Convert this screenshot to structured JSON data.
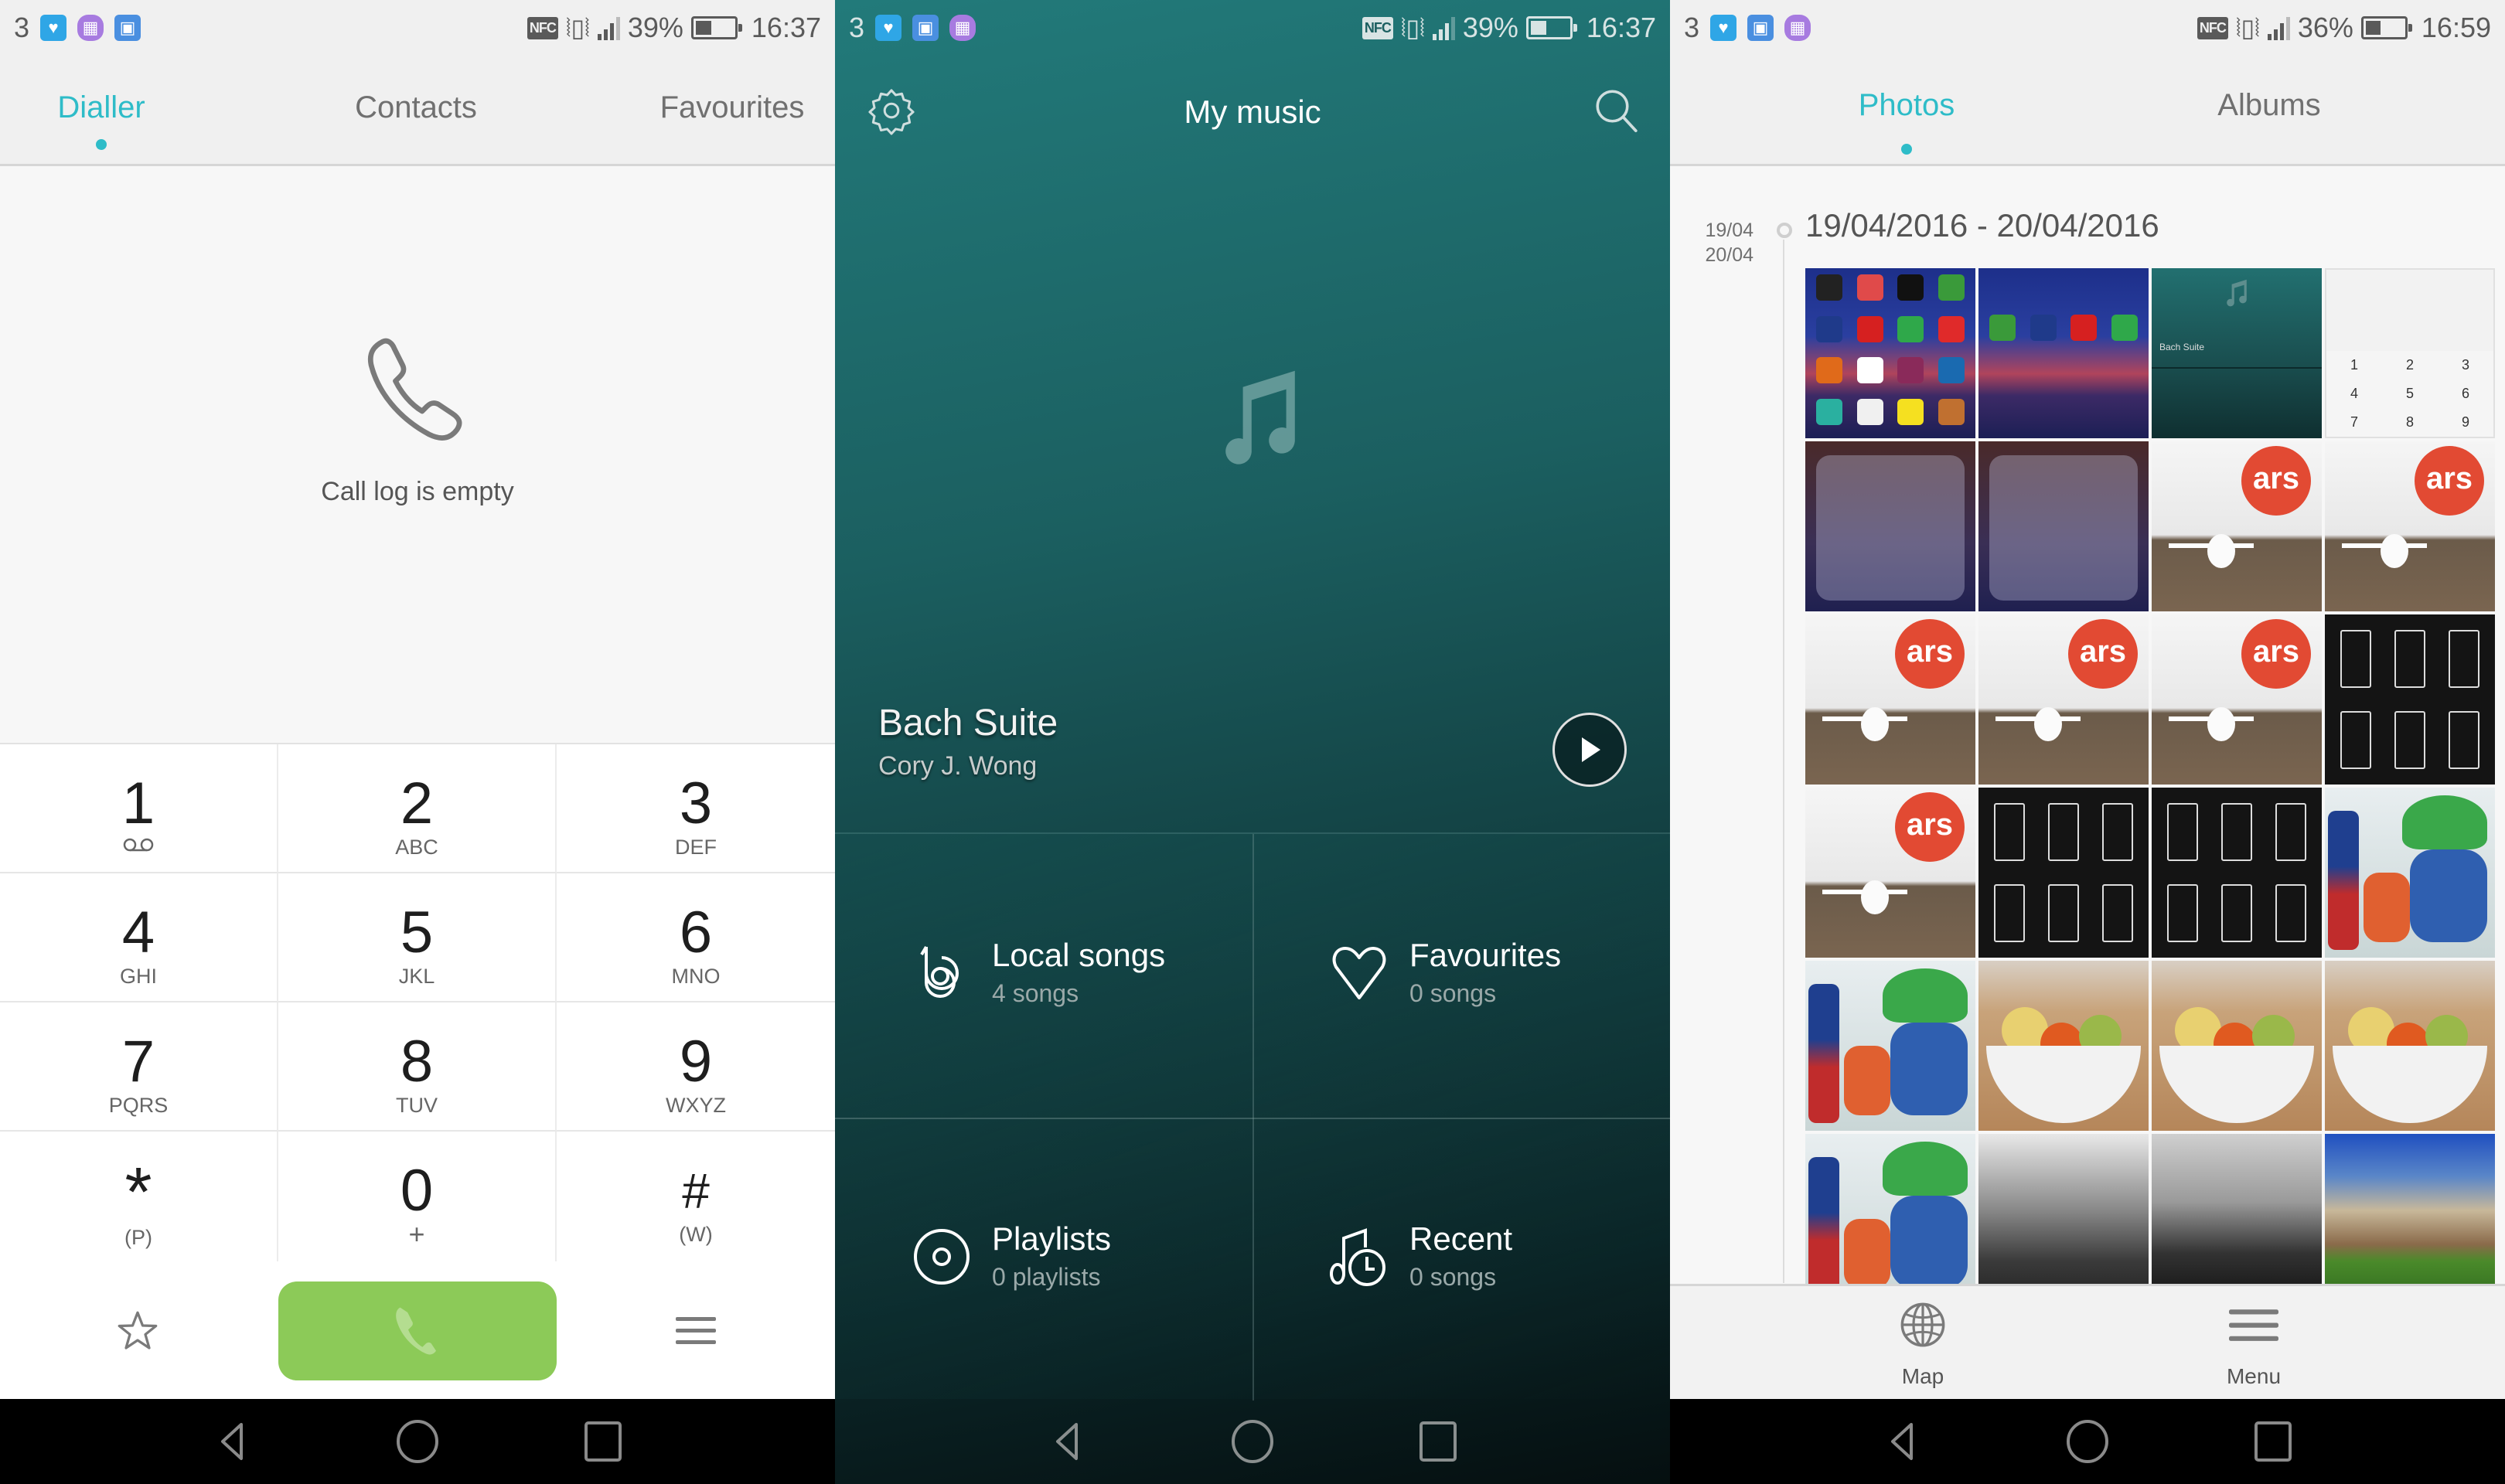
{
  "dialer": {
    "status": {
      "carrier": "3",
      "notification_icons": [
        "health-icon",
        "keyboard-icon",
        "gallery-icon"
      ],
      "nfc": "NFC",
      "battery": "39%",
      "battery_level": 0.39,
      "time": "16:37"
    },
    "tabs": [
      {
        "label": "Dialler",
        "active": true
      },
      {
        "label": "Contacts",
        "active": false
      },
      {
        "label": "Favourites",
        "active": false
      }
    ],
    "empty_state": {
      "icon": "phone-icon",
      "text": "Call log is empty"
    },
    "keys": [
      {
        "digit": "1",
        "letters": "voicemail"
      },
      {
        "digit": "2",
        "letters": "ABC"
      },
      {
        "digit": "3",
        "letters": "DEF"
      },
      {
        "digit": "4",
        "letters": "GHI"
      },
      {
        "digit": "5",
        "letters": "JKL"
      },
      {
        "digit": "6",
        "letters": "MNO"
      },
      {
        "digit": "7",
        "letters": "PQRS"
      },
      {
        "digit": "8",
        "letters": "TUV"
      },
      {
        "digit": "9",
        "letters": "WXYZ"
      },
      {
        "digit": "*",
        "letters": "(P)"
      },
      {
        "digit": "0",
        "letters": "+"
      },
      {
        "digit": "#",
        "letters": "(W)"
      }
    ],
    "bottom": {
      "left_icon": "star-icon",
      "call_icon": "phone-icon",
      "right_icon": "menu-icon"
    },
    "colors": {
      "accent": "#2ebcc8",
      "call_button": "#8cca58"
    }
  },
  "music": {
    "status": {
      "carrier": "3",
      "notification_icons": [
        "health-icon",
        "gallery-icon",
        "keyboard-icon"
      ],
      "nfc": "NFC",
      "battery": "39%",
      "battery_level": 0.39,
      "time": "16:37"
    },
    "title": "My music",
    "now_playing": {
      "title": "Bach Suite",
      "artist": "Cory J. Wong"
    },
    "categories": [
      {
        "label": "Local songs",
        "count": "4 songs",
        "icon": "local-songs-icon"
      },
      {
        "label": "Favourites",
        "count": "0 songs",
        "icon": "heart-icon"
      },
      {
        "label": "Playlists",
        "count": "0 playlists",
        "icon": "disc-icon"
      },
      {
        "label": "Recent",
        "count": "0 songs",
        "icon": "recent-clock-icon"
      }
    ]
  },
  "gallery": {
    "status": {
      "carrier": "3",
      "notification_icons": [
        "health-icon",
        "gallery-icon",
        "keyboard-icon"
      ],
      "nfc": "NFC",
      "battery": "36%",
      "battery_level": 0.36,
      "time": "16:59"
    },
    "tabs": [
      {
        "label": "Photos",
        "active": true
      },
      {
        "label": "Albums",
        "active": false
      }
    ],
    "timeline": {
      "start_short": "19/04",
      "end_short": "20/04",
      "heading": "19/04/2016 - 20/04/2016"
    },
    "photos": [
      {
        "kind": "home",
        "desc": "Home screen screenshot"
      },
      {
        "kind": "home",
        "desc": "Home screen screenshot with music widget"
      },
      {
        "kind": "music",
        "desc": "Music app screenshot"
      },
      {
        "kind": "dial",
        "desc": "Dialler screenshot"
      },
      {
        "kind": "folder",
        "desc": "Games folder screenshot"
      },
      {
        "kind": "folder",
        "desc": "Apps folder screenshot"
      },
      {
        "kind": "ars",
        "desc": "Office photo"
      },
      {
        "kind": "ars",
        "desc": "Office photo"
      },
      {
        "kind": "ars",
        "desc": "Office photo"
      },
      {
        "kind": "ars",
        "desc": "Office photo in pro mode"
      },
      {
        "kind": "ars",
        "desc": "Office photo"
      },
      {
        "kind": "dark",
        "desc": "Camera settings screenshot"
      },
      {
        "kind": "ars",
        "desc": "Office photo"
      },
      {
        "kind": "dark",
        "desc": "Camera modes screenshot"
      },
      {
        "kind": "dark",
        "desc": "Camera modes screenshot"
      },
      {
        "kind": "toys",
        "desc": "Toy figures photo"
      },
      {
        "kind": "toys",
        "desc": "Toy figures photo"
      },
      {
        "kind": "fruit",
        "desc": "Fruit bowl photo"
      },
      {
        "kind": "fruit",
        "desc": "Fruit bowl photo"
      },
      {
        "kind": "fruit",
        "desc": "Fruit bowl photo"
      },
      {
        "kind": "toys",
        "desc": "Toy figures photo"
      },
      {
        "kind": "bw1",
        "desc": "Black and white park photo"
      },
      {
        "kind": "bw2",
        "desc": "Black and white square photo"
      },
      {
        "kind": "park",
        "desc": "Park in spring photo"
      }
    ],
    "bottom": [
      {
        "label": "Map",
        "icon": "globe-icon"
      },
      {
        "label": "Menu",
        "icon": "menu-icon"
      }
    ]
  },
  "navbar": {
    "back": "back-icon",
    "home": "home-icon",
    "recents": "recents-icon"
  }
}
